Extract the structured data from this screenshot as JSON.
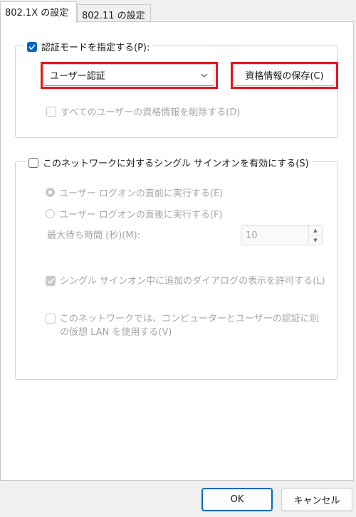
{
  "tabs": [
    {
      "label": "802.1X の設定",
      "active": true
    },
    {
      "label": "802.11 の設定",
      "active": false
    }
  ],
  "auth_mode": {
    "checkbox_label": "認証モードを指定する(P):",
    "checked": true,
    "select_value": "ユーザー認証",
    "save_credentials_label": "資格情報の保存(C)",
    "delete_all_label": "すべてのユーザーの資格情報を削除する(D)"
  },
  "sso": {
    "checkbox_label": "このネットワークに対するシングル サインオンを有効にする(S)",
    "checked": false,
    "radio_before_label": "ユーザー ログオンの直前に実行する(E)",
    "radio_after_label": "ユーザー ログオンの直後に実行する(F)",
    "max_delay_label": "最大待ち時間 (秒)(M):",
    "max_delay_value": "10",
    "allow_dialogs_label": "シングル サインオン中に追加のダイアログの表示を許可する(L)",
    "separate_vlan_label": "このネットワークでは、コンピューターとユーザーの認証に別の仮想 LAN を使用する(V)"
  },
  "footer": {
    "ok_label": "OK",
    "cancel_label": "キャンセル"
  },
  "highlight_color": "#e8141e",
  "accent_color": "#0067c0"
}
